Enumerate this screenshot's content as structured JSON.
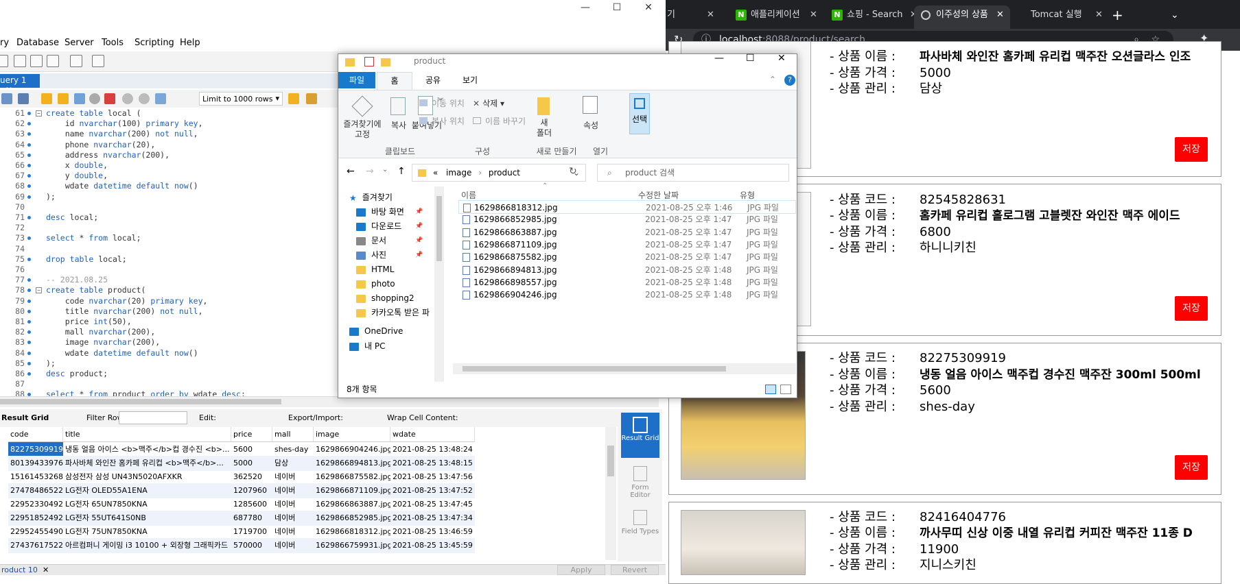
{
  "workbench": {
    "title_partial": "",
    "menu": [
      "ry",
      "Database",
      "Server",
      "Tools",
      "Scripting",
      "Help"
    ],
    "query_tab": "uery 1",
    "limit": "Limit to 1000 rows",
    "code_lines": [
      {
        "n": "61",
        "t": "create table local ("
      },
      {
        "n": "62",
        "t": "    id nvarchar(100) primary key,"
      },
      {
        "n": "63",
        "t": "    name nvarchar(200) not null,"
      },
      {
        "n": "64",
        "t": "    phone nvarchar(20),"
      },
      {
        "n": "65",
        "t": "    address nvarchar(200),"
      },
      {
        "n": "66",
        "t": "    x double,"
      },
      {
        "n": "67",
        "t": "    y double,"
      },
      {
        "n": "68",
        "t": "    wdate datetime default now()"
      },
      {
        "n": "69",
        "t": ");"
      },
      {
        "n": "70",
        "t": ""
      },
      {
        "n": "71",
        "t": "desc local;"
      },
      {
        "n": "72",
        "t": ""
      },
      {
        "n": "73",
        "t": "select * from local;"
      },
      {
        "n": "74",
        "t": ""
      },
      {
        "n": "75",
        "t": "drop table local;"
      },
      {
        "n": "76",
        "t": ""
      },
      {
        "n": "77",
        "t": "-- 2021.08.25"
      },
      {
        "n": "78",
        "t": "create table product("
      },
      {
        "n": "79",
        "t": "    code nvarchar(20) primary key,"
      },
      {
        "n": "80",
        "t": "    title nvarchar(200) not null,"
      },
      {
        "n": "81",
        "t": "    price int(50),"
      },
      {
        "n": "82",
        "t": "    mall nvarchar(200),"
      },
      {
        "n": "83",
        "t": "    image nvarchar(200),"
      },
      {
        "n": "84",
        "t": "    wdate datetime default now()"
      },
      {
        "n": "85",
        "t": ");"
      },
      {
        "n": "86",
        "t": "desc product;"
      },
      {
        "n": "87",
        "t": ""
      },
      {
        "n": "88",
        "t": "select * from product order by wdate desc;"
      }
    ],
    "result_toolbar": {
      "result_grid": "Result Grid",
      "filter_rows": "Filter Rows:",
      "edit": "Edit:",
      "export_import": "Export/Import:",
      "wrap": "Wrap Cell Content:"
    },
    "grid_headers": [
      "code",
      "title",
      "price",
      "mall",
      "image",
      "wdate"
    ],
    "grid_rows": [
      [
        "82275309919",
        "냉동 얼음 아이스 <b>맥주</b>컵 경수진 <b>...",
        "5600",
        "shes-day",
        "1629866904246.jpg",
        "2021-08-25 13:48:24"
      ],
      [
        "80139433976",
        "파사바체 와인잔 홈카페 유리컵 <b>맥주</b>...",
        "5000",
        "담상",
        "1629866894813.jpg",
        "2021-08-25 13:48:15"
      ],
      [
        "15161453268",
        "삼성전자 삼성 UN43N5020AFXKR",
        "362520",
        "네이버",
        "1629866875582.jpg",
        "2021-08-25 13:47:56"
      ],
      [
        "27478486522",
        "LG전자 OLED55A1ENA",
        "1207960",
        "네이버",
        "1629866871109.jpg",
        "2021-08-25 13:47:52"
      ],
      [
        "22952330492",
        "LG전자 65UN7850KNA",
        "1285600",
        "네이버",
        "1629866863887.jpg",
        "2021-08-25 13:47:45"
      ],
      [
        "22951852492",
        "LG전자 55UT641S0NB",
        "687780",
        "네이버",
        "1629866852985.jpg",
        "2021-08-25 13:47:34"
      ],
      [
        "22952455490",
        "LG전자 75UN7850KNA",
        "1719700",
        "네이버",
        "1629866818312.jpg",
        "2021-08-25 13:46:59"
      ],
      [
        "27437617522",
        "아르컴퍼니 게이밍 i3 10100 + 외장형 그래픽카드",
        "570000",
        "네이버",
        "1629866759931.jpg",
        "2021-08-25 13:45:59"
      ]
    ],
    "side_panel": {
      "result_grid": "Result Grid",
      "form_editor": "Form Editor",
      "field_types": "Field Types"
    },
    "status_tab": "roduct 10",
    "apply": "Apply",
    "revert": "Revert"
  },
  "chrome": {
    "tabs": [
      {
        "label": "기",
        "active": false
      },
      {
        "label": "애플리케이션",
        "active": false,
        "favicon": "N"
      },
      {
        "label": "쇼핑 - Search",
        "active": false,
        "favicon": "N"
      },
      {
        "label": "이주성의 상품",
        "active": true
      },
      {
        "label": "Tomcat 실행",
        "active": false
      }
    ],
    "url_host": "localhost",
    "url_rest": ":8088/product/search",
    "product_labels": {
      "code": "- 상품 코드 :",
      "title": "- 상품 이름 :",
      "price": "- 상품 가격 :",
      "mall": "- 상품 관리 :"
    },
    "products": [
      {
        "code": "",
        "title": "파사바체 와인잔 홈카페 유리컵 맥주잔 오션글라스 인조",
        "price": "5000",
        "mall": "담상",
        "save": "저장"
      },
      {
        "code": "82545828631",
        "title": "홈카페 유리컵 홀로그램 고블렛잔 와인잔 맥주 에이드",
        "price": "6800",
        "mall": "하니니키친",
        "save": "저장"
      },
      {
        "code": "82275309919",
        "title": "냉동 얼음 아이스 맥주컵 경수진 맥주잔 300ml 500ml",
        "price": "5600",
        "mall": "shes-day",
        "save": "저장"
      },
      {
        "code": "82416404776",
        "title": "까사무띠 신상 이중 내열 유리컵 커피잔 맥주잔 11종 D",
        "price": "11900",
        "mall": "지니스키친",
        "save": ""
      }
    ]
  },
  "explorer": {
    "title": "product",
    "ribbon_tabs": [
      "파일",
      "홈",
      "공유",
      "보기"
    ],
    "ribbon": {
      "pin": "즐겨찾기에\n고정",
      "copy": "복사",
      "paste": "붙여넣기",
      "clipboard": "클립보드",
      "move_to": "이동 위치",
      "copy_to": "복사 위치",
      "delete": "삭제",
      "rename": "이름 바꾸기",
      "organize": "구성",
      "new_folder": "새\n폴더",
      "new": "새로 만들기",
      "properties": "속성",
      "open": "열기",
      "select": "선택"
    },
    "path": [
      "image",
      "product"
    ],
    "search_placeholder": "product 검색",
    "tree": [
      {
        "label": "즐겨찾기",
        "type": "star"
      },
      {
        "label": "바탕 화면",
        "type": "desktop",
        "pinned": true
      },
      {
        "label": "다운로드",
        "type": "download",
        "pinned": true
      },
      {
        "label": "문서",
        "type": "doc",
        "pinned": true
      },
      {
        "label": "사진",
        "type": "pic",
        "pinned": true
      },
      {
        "label": "HTML",
        "type": "folder"
      },
      {
        "label": "photo",
        "type": "folder"
      },
      {
        "label": "shopping2",
        "type": "folder"
      },
      {
        "label": "카카오톡 받은 파",
        "type": "folder"
      },
      {
        "label": "OneDrive",
        "type": "cloud"
      },
      {
        "label": "내 PC",
        "type": "pc"
      }
    ],
    "columns": [
      "이름",
      "수정한 날짜",
      "유형"
    ],
    "files": [
      {
        "name": "1629866818312.jpg",
        "date": "2021-08-25 오후 1:46",
        "type": "JPG 파일"
      },
      {
        "name": "1629866852985.jpg",
        "date": "2021-08-25 오후 1:47",
        "type": "JPG 파일"
      },
      {
        "name": "1629866863887.jpg",
        "date": "2021-08-25 오후 1:47",
        "type": "JPG 파일"
      },
      {
        "name": "1629866871109.jpg",
        "date": "2021-08-25 오후 1:47",
        "type": "JPG 파일"
      },
      {
        "name": "1629866875582.jpg",
        "date": "2021-08-25 오후 1:47",
        "type": "JPG 파일"
      },
      {
        "name": "1629866894813.jpg",
        "date": "2021-08-25 오후 1:48",
        "type": "JPG 파일"
      },
      {
        "name": "1629866898557.jpg",
        "date": "2021-08-25 오후 1:48",
        "type": "JPG 파일"
      },
      {
        "name": "1629866904246.jpg",
        "date": "2021-08-25 오후 1:48",
        "type": "JPG 파일"
      }
    ],
    "item_count": "8개 항목"
  }
}
